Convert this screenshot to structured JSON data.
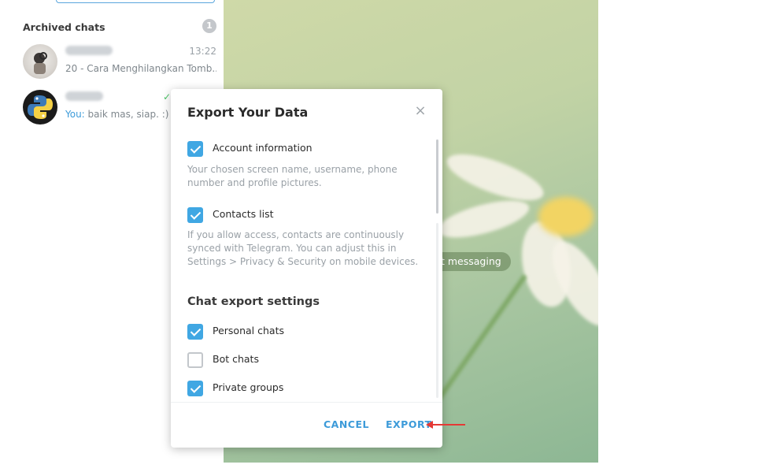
{
  "sidebar": {
    "archived": {
      "title": "Archived chats",
      "count": "1"
    },
    "chats": [
      {
        "time": "13:22",
        "preview": "20 - Cara Menghilangkan Tomb..."
      },
      {
        "you_label": "You:",
        "preview": " baik mas, siap. :)"
      }
    ]
  },
  "background": {
    "start_pill": "t messaging"
  },
  "dialog": {
    "title": "Export Your Data",
    "close_icon": "×",
    "options": [
      {
        "label": "Account information",
        "checked": true
      },
      {
        "label": "Contacts list",
        "checked": true
      },
      {
        "label": "Personal chats",
        "checked": true
      },
      {
        "label": "Bot chats",
        "checked": false
      },
      {
        "label": "Private groups",
        "checked": true
      }
    ],
    "descriptions": {
      "account": "Your chosen screen name, username, phone number and profile pictures.",
      "contacts": "If you allow access, contacts are continuously synced with Telegram. You can adjust this in Settings > Privacy & Security on mobile devices."
    },
    "section_title": "Chat export settings",
    "buttons": {
      "cancel": "CANCEL",
      "export": "EXPORT"
    }
  },
  "colors": {
    "accent": "#40a7e3",
    "link": "#3d9bd9",
    "annotation": "#e53935"
  }
}
